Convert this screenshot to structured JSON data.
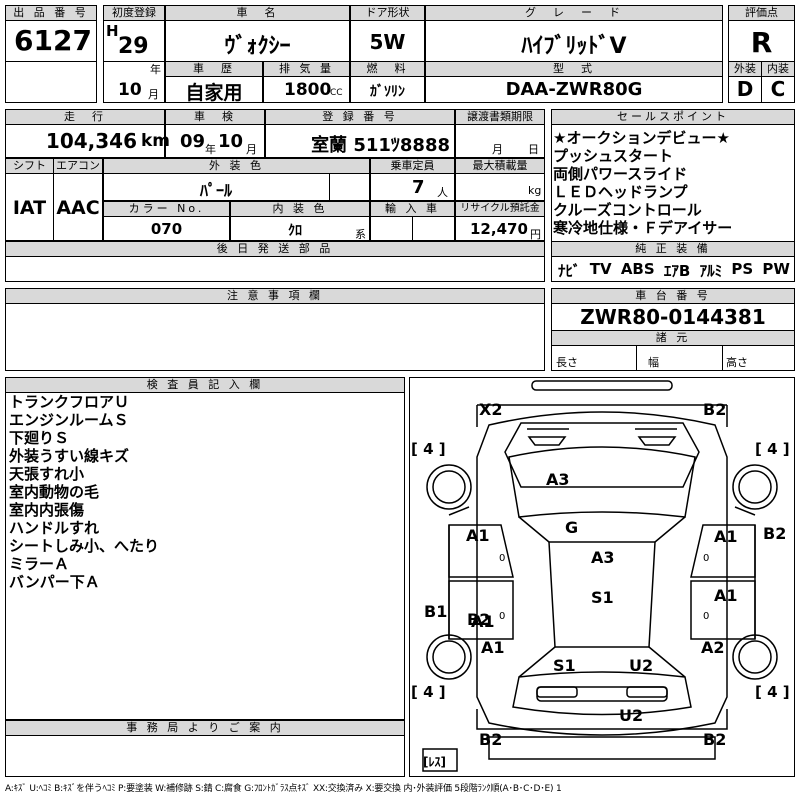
{
  "top": {
    "lot_label": "出 品 番 号",
    "lot": "6127",
    "first_reg_label": "初度登録",
    "era": "H",
    "year": "29",
    "year_unit": "年",
    "month": "10",
    "month_unit": "月",
    "name_label": "車　名",
    "name": "ｳﾞｫｸｼｰ",
    "door_label": "ドア形状",
    "door": "5W",
    "grade_label": "グ　レ　ー　ド",
    "grade": "ﾊｲﾌﾞﾘｯﾄﾞV",
    "score_label": "評価点",
    "score": "R",
    "history_label": "車　歴",
    "history": "自家用",
    "displacement_label": "排 気 量",
    "displacement": "1800",
    "displacement_unit": "CC",
    "fuel_label": "燃　料",
    "fuel": "ｶﾞｿﾘﾝ",
    "model_label": "型　式",
    "model": "DAA-ZWR80G",
    "ext_label": "外装",
    "ext": "D",
    "int_label": "内装",
    "int": "C"
  },
  "mid": {
    "mileage_label": "走　行",
    "mileage": "104,346",
    "mileage_unit": "km",
    "inspection_label": "車　検",
    "insp_year": "09",
    "insp_year_unit": "年",
    "insp_month": "10",
    "insp_month_unit": "月",
    "plate_label": "登 録 番 号",
    "plate": "室蘭 511ﾂ8888",
    "deadline_label": "譲渡書類期限",
    "deadline_month_unit": "月",
    "deadline_day_unit": "日",
    "shift_label": "シフト",
    "shift": "IAT",
    "ac_label": "エアコン",
    "ac": "AAC",
    "color_label": "外 装 色",
    "color": "ﾊﾟｰﾙ",
    "capacity_label": "乗車定員",
    "capacity": "7",
    "capacity_unit": "人",
    "load_label": "最大積載量",
    "load_unit": "kg",
    "colorno_label": "カラー No.",
    "colorno": "070",
    "interior_label": "内 装 色",
    "interior": "ｸﾛ",
    "interior_unit": "系",
    "import_label": "輸 入 車",
    "recycle_label": "リサイクル預託金",
    "recycle": "12,470",
    "recycle_unit": "円",
    "later_label": "後 日 発 送 部 品"
  },
  "sales": {
    "label": "セールスポイント",
    "lines": [
      "★オークションデビュー★",
      "プッシュスタート",
      "両側パワースライド",
      "ＬＥＤヘッドランプ",
      "クルーズコントロール",
      "寒冷地仕様・Ｆデアイサー"
    ],
    "equip_label": "純 正 装 備",
    "equip": [
      "ﾅﾋﾞ",
      "TV",
      "ABS",
      "ｴｱB",
      "ｱﾙﾐ",
      "PS",
      "PW"
    ]
  },
  "notes": {
    "label": "注 意 事 項 欄"
  },
  "chassis": {
    "label": "車 台 番 号",
    "number": "ZWR80-0144381",
    "spec_label": "諸 元",
    "length_label": "長さ",
    "width_label": "幅",
    "height_label": "高さ"
  },
  "inspector": {
    "label": "検 査 員 記 入 欄",
    "lines": [
      "トランクフロアＵ",
      "エンジンルームＳ",
      "下廻りＳ",
      "外装うすい線キズ",
      "天張すれ小",
      "室内動物の毛",
      "室内内張傷",
      "ハンドルすれ",
      "シートしみ小、へたり",
      "ミラーＡ",
      "バンパー下Ａ"
    ]
  },
  "office": {
    "label": "事 務 局 よ り ご 案 内"
  },
  "diagram": {
    "tags": [
      "X2",
      "B2",
      "A3",
      "G",
      "A3",
      "S1",
      "A1",
      "A1",
      "B2",
      "A1",
      "A1",
      "B1",
      "B2",
      "A1",
      "A2",
      "S1",
      "U2",
      "U2",
      "B2",
      "B2"
    ],
    "tire_left_top": "[ 4 ]",
    "tire_right_top": "[ 4 ]",
    "tire_left_bottom": "[ 4 ]",
    "tire_right_bottom": "[ 4 ]",
    "spare": "[ﾚｽ]"
  },
  "legend": "A:ｷｽﾞ U:ﾍｺﾐ B:ｷｽﾞを伴うﾍｺﾐ P:要塗装 W:補修跡 S:錆 C:腐食 G:ﾌﾛﾝﾄｶﾞﾗｽ点ｷｽﾞ XX:交換済み X:要交換 内･外装評価 5段階ﾗﾝｸ順(A･B･C･D･E) 1"
}
